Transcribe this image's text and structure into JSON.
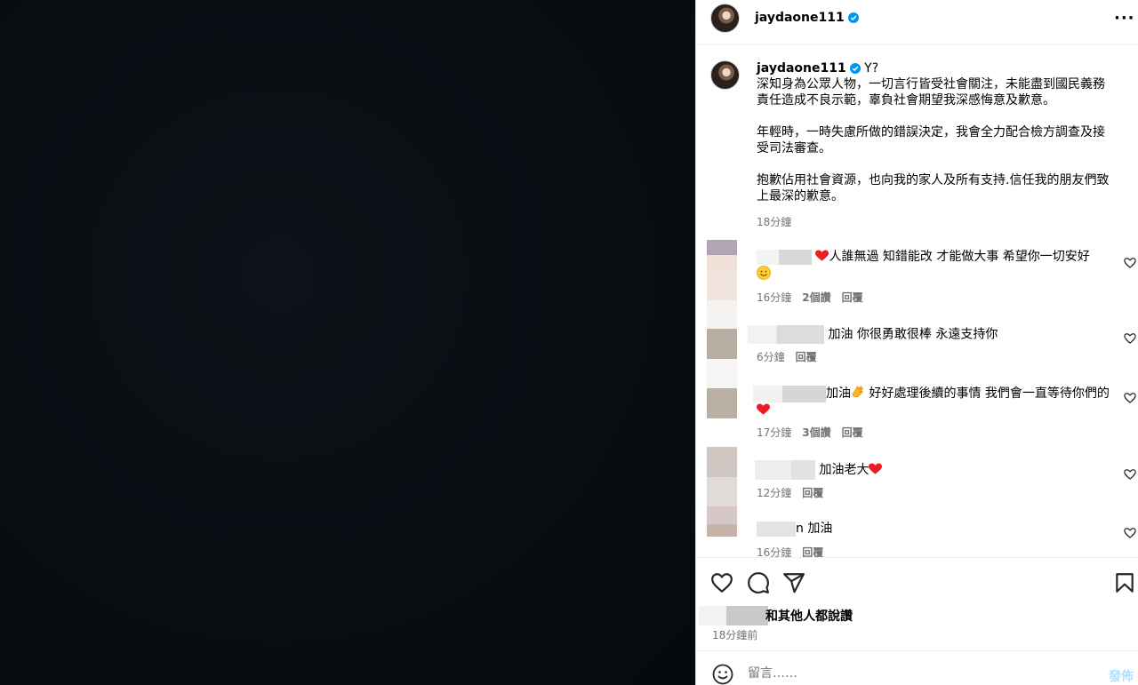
{
  "post": {
    "username": "jaydaone111",
    "more_icon": "more-horizontal-icon",
    "verified_icon": "verified-badge-icon"
  },
  "caption": {
    "username": "jaydaone111",
    "first_line_suffix": "Y?",
    "p1": "深知身為公眾人物，一切言行皆受社會關注，未能盡到國民義務責任造成不良示範，辜負社會期望我深感悔意及歉意。",
    "p2": "年輕時，一時失慮所做的錯誤決定，我會全力配合檢方調查及接受司法審查。",
    "p3": "抱歉佔用社會資源，也向我的家人及所有支持.信任我的朋友們致上最深的歉意。",
    "time": "18分鐘"
  },
  "comments": [
    {
      "text": "人誰無過 知錯能改 才能做大事 希望你一切安好",
      "time": "16分鐘",
      "likes": "2個讚",
      "reply": "回覆"
    },
    {
      "text": "加油 你很勇敢很棒 永遠支持你",
      "time": "6分鐘",
      "reply": "回覆"
    },
    {
      "text_a": "加油",
      "text_b": " 好好處理後續的事情 我們會一直等待你們的",
      "time": "17分鐘",
      "likes": "3個讚",
      "reply": "回覆"
    },
    {
      "text": "加油老大",
      "time": "12分鐘",
      "reply": "回覆"
    },
    {
      "prefix": "n",
      "text": "加油",
      "time": "16分鐘",
      "reply": "回覆"
    }
  ],
  "footer": {
    "likes_text": "和其他人都說讚",
    "likes_prefix_visible": "和",
    "likes_rest": "其他人都說讚",
    "post_time": "18分鐘前",
    "comment_placeholder": "留言……",
    "post_button": "發佈"
  },
  "icons": {
    "like": "heart-outline-icon",
    "comment": "comment-bubble-icon",
    "share": "paper-plane-icon",
    "save": "bookmark-icon",
    "emoji": "smiley-icon"
  },
  "colors": {
    "verified": "#0095f6",
    "heart_red": "#ed1c24",
    "post_button": "#b2dffc",
    "meta_gray": "#737373"
  }
}
